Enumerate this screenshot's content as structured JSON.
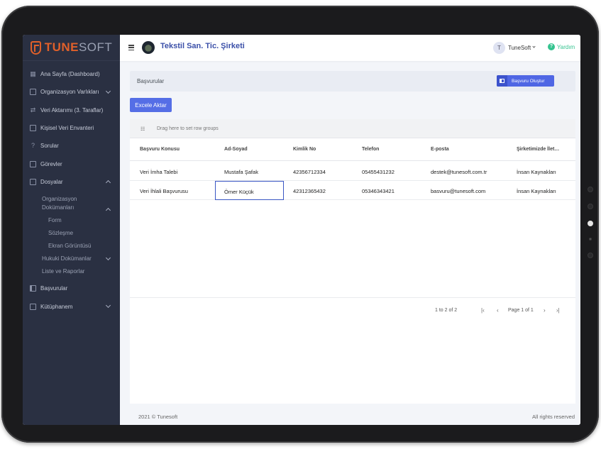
{
  "brand": {
    "logo_a": "TUNE",
    "logo_b": "SOFT"
  },
  "sidebar": {
    "items": [
      {
        "label": "Ana Sayfa (Dashboard)",
        "icon": "dashboard-icon"
      },
      {
        "label": "Organizasyon Varlıkları",
        "icon": "building-icon"
      },
      {
        "label": "Veri Aktarımı (3. Taraflar)",
        "icon": "transfer-icon"
      },
      {
        "label": "Kişisel Veri Envanteri",
        "icon": "table-icon"
      },
      {
        "label": "Sorular",
        "icon": "question-icon"
      },
      {
        "label": "Görevler",
        "icon": "checkbox-icon"
      },
      {
        "label": "Dosyalar",
        "icon": "folder-icon"
      }
    ],
    "sub": {
      "org_docs_line1": "Organizasyon",
      "org_docs_line2": "Dokümanları",
      "form": "Form",
      "contract": "Sözleşme",
      "screenshot": "Ekran Görüntüsü",
      "legal_docs": "Hukuki Dokümanlar",
      "lists": "Liste ve Raporlar"
    },
    "applications": "Başvurular",
    "library": "Kütüphanem"
  },
  "header": {
    "company": "Tekstil San. Tic. Şirketi",
    "user_initial": "T",
    "user_name": "TuneSoft",
    "help": "Yardım",
    "help_symbol": "?"
  },
  "page": {
    "title": "Başvurular",
    "create_button": "Başvuru Oluştur",
    "export_button": "Excele Aktar"
  },
  "grid": {
    "group_hint": "Drag here to set row groups",
    "columns": [
      "Başvuru Konusu",
      "Ad-Soyad",
      "Kimlik No",
      "Telefon",
      "E-posta",
      "Şirketimizde İlet…"
    ],
    "rows": [
      [
        "Veri İmha Talebi",
        "Mustafa Şafak",
        "42356712334",
        "05455431232",
        "destek@tunesoft.com.tr",
        "İnsan Kaynakları"
      ],
      [
        "Veri İhlali Başvurusu",
        "Ömer Küçük",
        "42312365432",
        "05346343421",
        "basvuru@tunesoft.com",
        "İnsan Kaynakları"
      ]
    ],
    "pager": {
      "info": "1 to 2 of 2",
      "page": "Page 1 of 1"
    }
  },
  "footer": {
    "left": "2021 © Tunesoft",
    "right": "All rights reserved"
  },
  "colors": {
    "sidebar_bg": "#2a3042",
    "accent": "#556ee6",
    "brand_orange": "#e0602a",
    "success": "#34c38f"
  }
}
